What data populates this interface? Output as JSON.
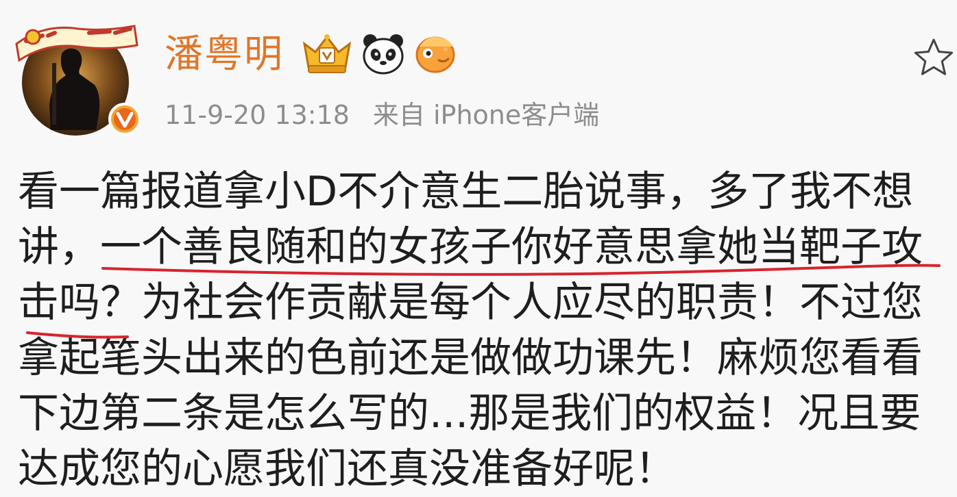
{
  "user": {
    "name": "潘粤明",
    "avatar_icon": "avatar-photo-icon",
    "verified_icon": "verified-v-icon",
    "badges": [
      "vip-crown-badge-icon",
      "panda-badge-icon",
      "fish-badge-icon"
    ]
  },
  "post": {
    "time": "11-9-20 13:18",
    "source": "来自 iPhone客户端",
    "lines": [
      "看一篇报道拿小D不介意生二胎说事，多了我不想",
      "讲，一个善良随和的女孩子你好意思拿她当靶子攻",
      "击吗？为社会作贡献是每个人应尽的职责！不过您",
      "拿起笔头出来的色前还是做做功课先！麻烦您看看",
      "下边第二条是怎么写的...那是我们的权益！况且要",
      "达成您的心愿我们还真没准备好呢！"
    ]
  },
  "actions": {
    "favorite_icon": "star-icon"
  },
  "colors": {
    "username": "#e0762a",
    "meta": "#8d8d8d",
    "text": "#1e1e1e",
    "underline": "#d9232e",
    "background": "#f8f8f8"
  }
}
